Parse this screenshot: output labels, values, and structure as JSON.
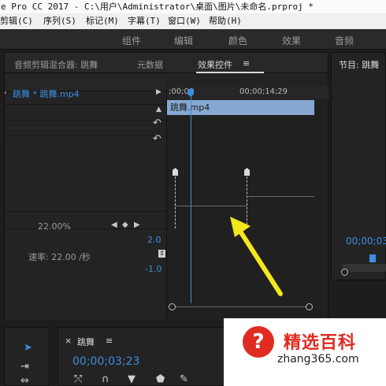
{
  "window": {
    "title": "e Pro CC 2017 - C:\\用户\\Administrator\\桌面\\图片\\未命名.prproj *"
  },
  "menu": {
    "items": [
      "剪辑(C)",
      "序列(S)",
      "标记(M)",
      "字幕(T)",
      "窗口(W)",
      "帮助(H)"
    ]
  },
  "workspaces": {
    "items": [
      "组件",
      "编辑",
      "颜色",
      "效果",
      "音频"
    ]
  },
  "effect_panel": {
    "tabs": [
      "音频剪辑混合器: 跳舞",
      "元数据",
      "效果控件"
    ],
    "menu_glyph": "≡",
    "clip_label": "跳舞 * 跳舞.mp4",
    "scale_value": "22.00%",
    "speed_label": "速率: 22.00 /秒",
    "graph_max": "2.0",
    "graph_min": "-1.0"
  },
  "timeline_mini": {
    "start_tc": ";00;00",
    "end_tc": "00;00;14;29",
    "clip_name": "跳舞.mp4"
  },
  "program_monitor": {
    "tab": "节目: 跳舞",
    "timecode": "00;00;03"
  },
  "sequence": {
    "close_glyph": "×",
    "tab": "跳舞",
    "menu_glyph": "≡",
    "timecode": "00;00;03;23"
  },
  "watermark": {
    "badge": "?",
    "title": "精选百科",
    "url": "zhang365.com"
  },
  "colors": {
    "accent": "#3c8ee0",
    "clip": "#86a7d2",
    "arrow": "#f5e71d",
    "brand": "#e02b22"
  }
}
